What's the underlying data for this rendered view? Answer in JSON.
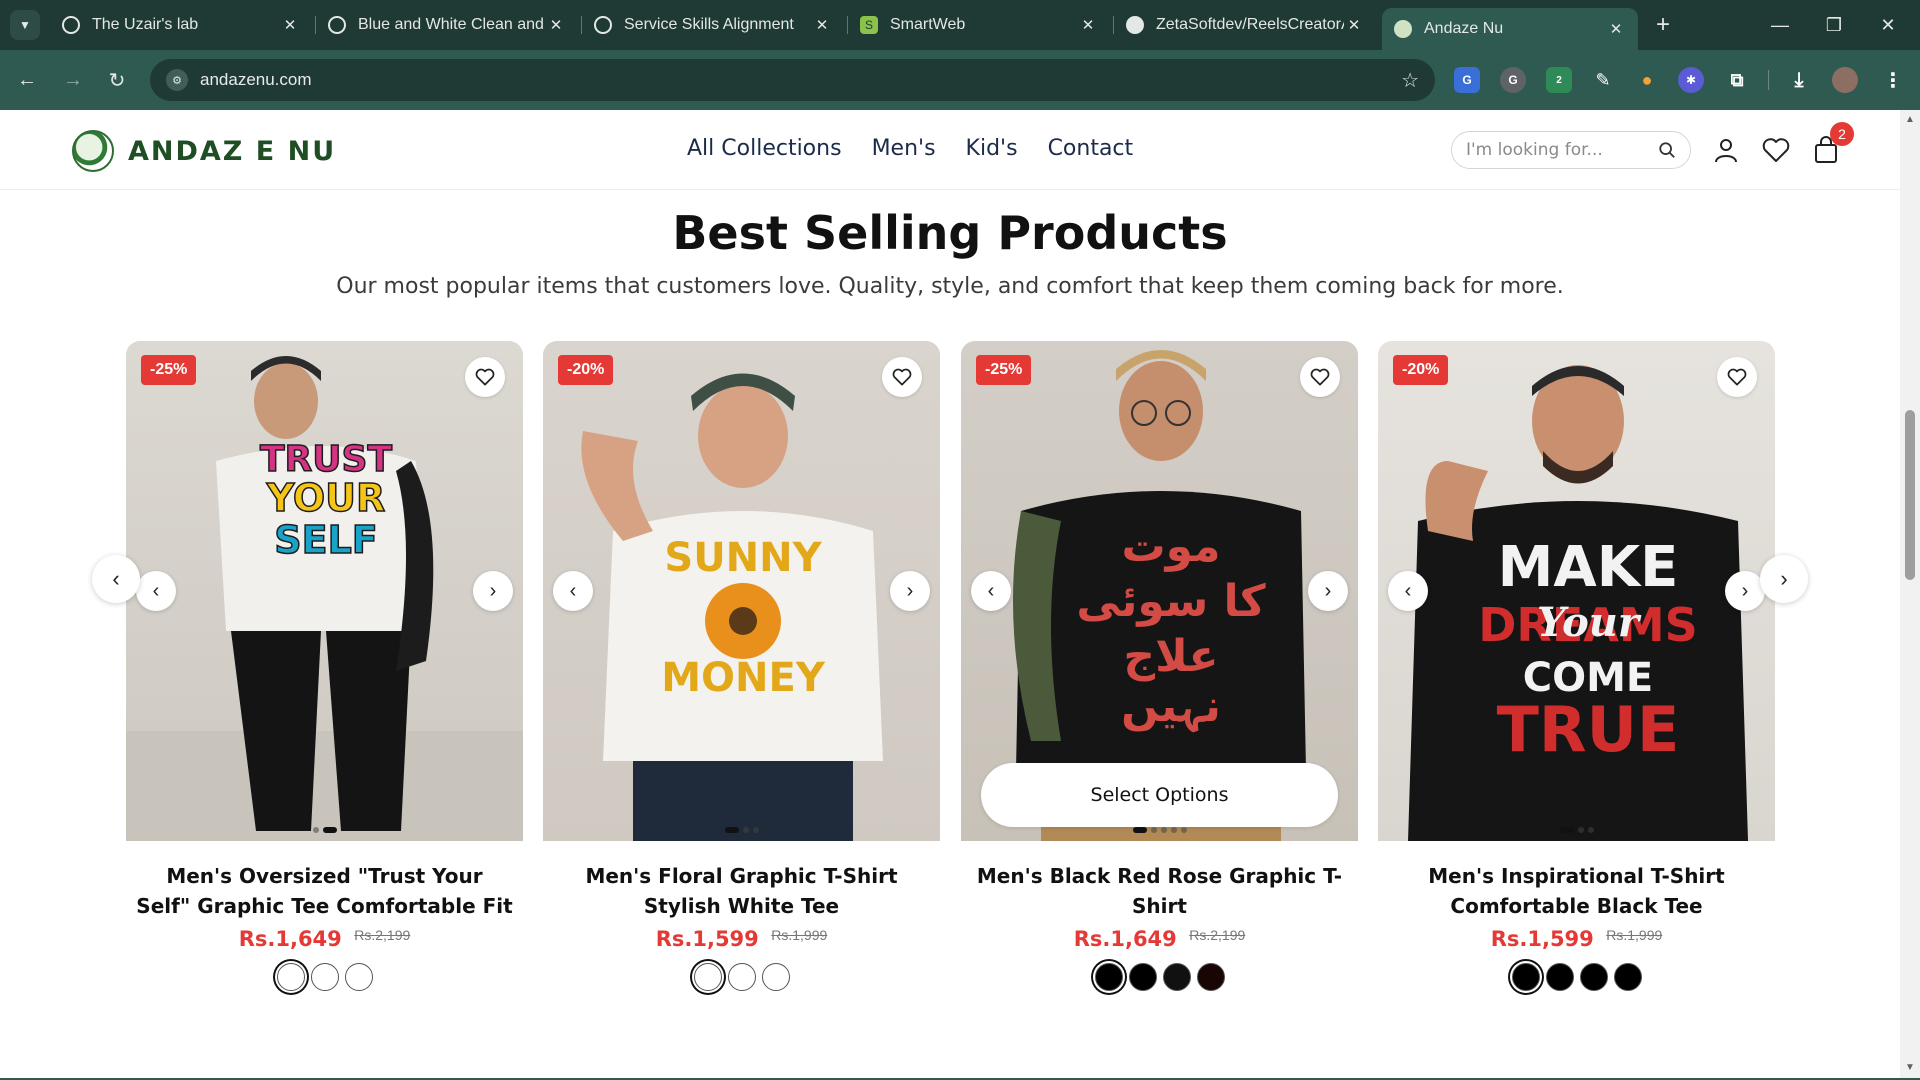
{
  "browser": {
    "tabs": [
      {
        "title": "The Uzair's lab",
        "active": false
      },
      {
        "title": "Blue and White Clean and Modern",
        "active": false
      },
      {
        "title": "Service Skills Alignment",
        "active": false
      },
      {
        "title": "SmartWeb",
        "active": false
      },
      {
        "title": "ZetaSoftdev/ReelsCreatorAI",
        "active": false
      },
      {
        "title": "Andaze Nu",
        "active": true
      }
    ],
    "url": "andazenu.com",
    "extension_badge": "2"
  },
  "header": {
    "logo_text": "ANDAZ E NU",
    "nav": [
      "All Collections",
      "Men's",
      "Kid's",
      "Contact"
    ],
    "search_placeholder": "I'm looking for...",
    "cart_count": "2"
  },
  "section": {
    "title": "Best Selling Products",
    "subtitle": "Our most popular items that customers love. Quality, style, and comfort that keep them coming back for more."
  },
  "products": [
    {
      "discount": "-25%",
      "name": "Men's Oversized \"Trust Your Self\" Graphic Tee Comfortable Fit",
      "price": "Rs.1,649",
      "old_price": "Rs.2,199",
      "shirt_color": "#f2f0ec",
      "swatches": [
        "#ffffff",
        "#ffffff",
        "#ffffff"
      ],
      "graphic_lines": [
        "TRUST",
        "YOUR",
        "SELF"
      ]
    },
    {
      "discount": "-20%",
      "name": "Men's Floral Graphic T-Shirt Stylish White Tee",
      "price": "Rs.1,599",
      "old_price": "Rs.1,999",
      "shirt_color": "#f4f2ee",
      "swatches": [
        "#ffffff",
        "#ffffff",
        "#ffffff"
      ],
      "graphic_lines": [
        "SUNNY",
        "MONEY"
      ]
    },
    {
      "discount": "-25%",
      "name": "Men's Black Red Rose Graphic T-Shirt",
      "price": "Rs.1,649",
      "old_price": "Rs.2,199",
      "shirt_color": "#151515",
      "swatches": [
        "#000000",
        "#000000",
        "#111111",
        "#1a0505"
      ],
      "select_label": "Select Options",
      "graphic_lines": [
        "موت",
        "کا سوئی",
        "علاج",
        "نہیں"
      ]
    },
    {
      "discount": "-20%",
      "name": "Men's Inspirational T-Shirt Comfortable Black Tee",
      "price": "Rs.1,599",
      "old_price": "Rs.1,999",
      "shirt_color": "#151515",
      "swatches": [
        "#000000",
        "#000000",
        "#000000",
        "#000000"
      ],
      "graphic_lines": [
        "MAKE",
        "DREAMS",
        "Your",
        "COME",
        "TRUE"
      ]
    }
  ],
  "colors": {
    "brand_green": "#1f4d24",
    "sale_red": "#e53935",
    "browser_dark": "#1f3a34",
    "browser_toolbar": "#2f5a52"
  }
}
